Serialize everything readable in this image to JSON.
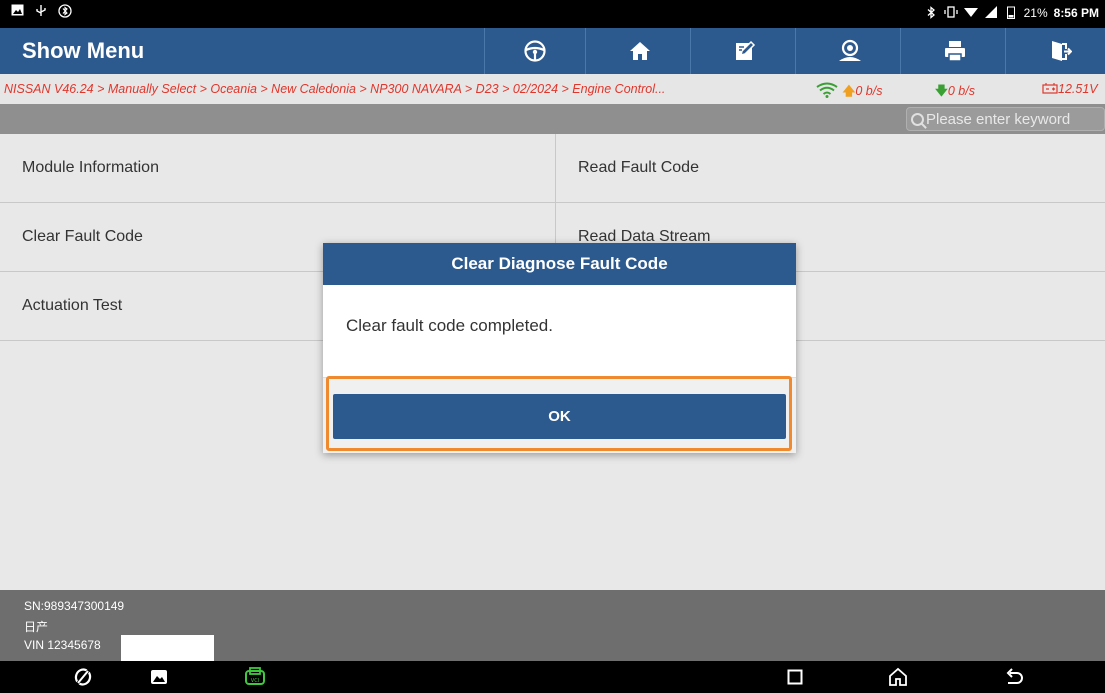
{
  "status_bar": {
    "battery": "21%",
    "time": "8:56 PM"
  },
  "header": {
    "title": "Show Menu",
    "toolbar_icons": [
      "steering-wheel-icon",
      "home-icon",
      "edit-icon",
      "user-icon",
      "print-icon",
      "exit-icon"
    ]
  },
  "breadcrumb": {
    "path": "NISSAN V46.24 > Manually Select > Oceania > New Caledonia > NP300 NAVARA > D23 > 02/2024 > Engine Control...",
    "upload_rate": "0 b/s",
    "download_rate": "0 b/s",
    "voltage": "12.51V"
  },
  "search": {
    "placeholder": "Please enter keyword"
  },
  "menu": {
    "items": [
      {
        "label": "Module Information"
      },
      {
        "label": "Read Fault Code"
      },
      {
        "label": "Clear Fault Code"
      },
      {
        "label": "Read Data Stream"
      },
      {
        "label": "Actuation Test"
      },
      {
        "label": ""
      }
    ]
  },
  "footer": {
    "sn": "SN:989347300149",
    "make": "日产",
    "vin": "VIN 12345678"
  },
  "dialog": {
    "title": "Clear Diagnose Fault Code",
    "message": "Clear fault code completed.",
    "ok_label": "OK"
  },
  "colors": {
    "header_blue": "#2c5a8f",
    "breadcrumb_red": "#e0362b",
    "highlight_orange": "#f08a2e"
  }
}
